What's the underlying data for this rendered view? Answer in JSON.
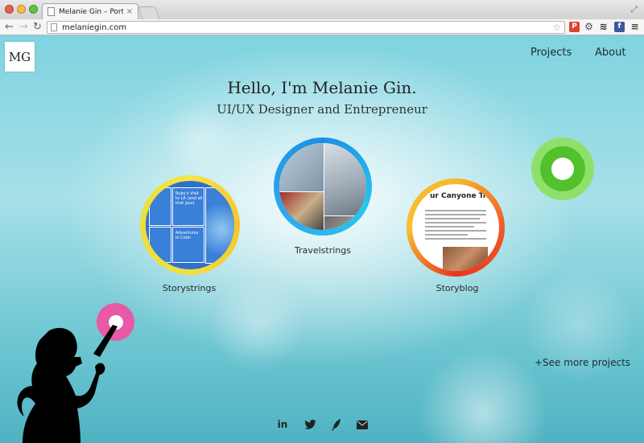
{
  "browser": {
    "tab_title": "Melanie Gin – Portfolio",
    "tab_close": "×",
    "url": "melaniegin.com"
  },
  "site": {
    "logo": "MG",
    "nav": {
      "projects": "Projects",
      "about": "About"
    },
    "hero_title": "Hello, I'm Melanie Gin.",
    "hero_subtitle": "UI/UX Designer and Entrepreneur",
    "projects": [
      {
        "label": "Travelstrings"
      },
      {
        "label": "Storystrings"
      },
      {
        "label": "Storyblog"
      }
    ],
    "see_more": "+See more projects",
    "storystrings_preview": {
      "tile1": "Ruby's Visit to LA (and all that jazz)",
      "tile2": "Adventures in Color"
    },
    "storyblog_preview": {
      "title": "ur Canyone Trip!"
    },
    "social": {
      "linkedin": "in"
    }
  },
  "colors": {
    "ring_travelstrings": "#1f8fe3",
    "ring_storystrings": "#f4e54a",
    "ring_storyblog": "#f05a28",
    "dot_green": "#52c12c",
    "dot_pink": "#e85aa6"
  },
  "icons": [
    "doc-icon",
    "back-icon",
    "forward-icon",
    "reload-icon",
    "star-icon",
    "linkedin-icon",
    "twitter-icon",
    "quill-icon",
    "mail-icon"
  ]
}
